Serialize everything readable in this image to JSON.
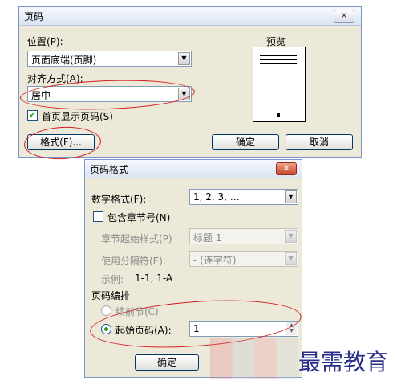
{
  "page_number_dialog": {
    "title": "页码",
    "position_label": "位置(P):",
    "position_value": "页面底端(页脚)",
    "alignment_label": "对齐方式(A):",
    "alignment_value": "居中",
    "show_first_page_label": "首页显示页码(S)",
    "show_first_page_checked": true,
    "preview_label": "预览",
    "format_button": "格式(F)...",
    "ok_button": "确定",
    "cancel_button": "取消"
  },
  "format_dialog": {
    "title": "页码格式",
    "number_format_label": "数字格式(F):",
    "number_format_value": "1, 2, 3, …",
    "include_chapter_label": "包含章节号(N)",
    "include_chapter_checked": false,
    "chapter_style_label": "章节起始样式(P)",
    "chapter_style_value": "标题 1",
    "separator_label": "使用分隔符(E):",
    "separator_value": "-  (连字符)",
    "example_label": "示例:",
    "example_value": "1-1, 1-A",
    "numbering_group_label": "页码编排",
    "continue_label": "续前节(C)",
    "start_at_label": "起始页码(A):",
    "start_at_value": "1",
    "selected_option": "start_at",
    "ok_button": "确定"
  },
  "watermark": {
    "text": "最需教育"
  },
  "colors": {
    "annotation_red": "#d21e1e",
    "dialog_face": "#ece9d8"
  },
  "icons": {
    "close": "close-icon",
    "dropdown": "chevron-down-icon",
    "check": "checkmark-icon"
  }
}
